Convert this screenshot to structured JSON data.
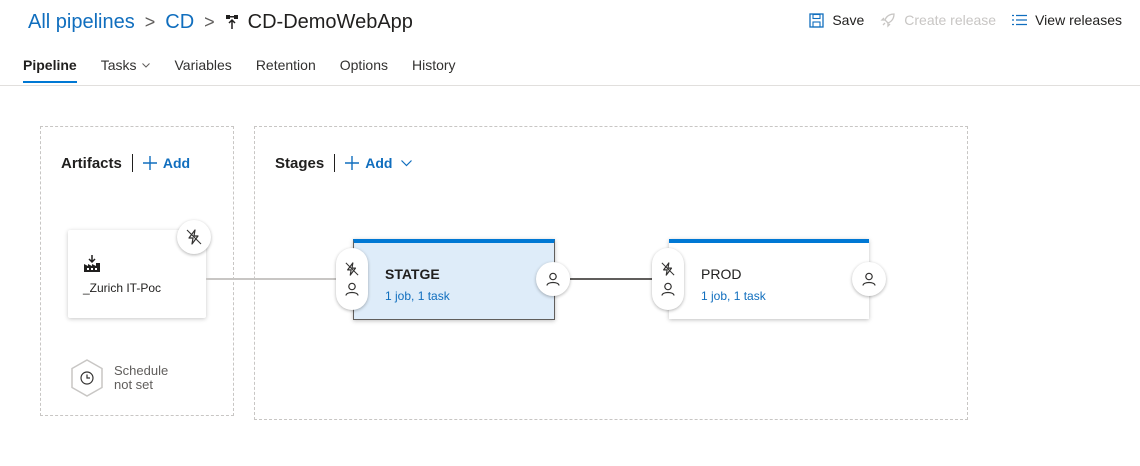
{
  "breadcrumb": {
    "root": "All pipelines",
    "folder": "CD",
    "current": "CD-DemoWebApp",
    "separator": ">"
  },
  "toolbar": {
    "save_label": "Save",
    "create_release_label": "Create release",
    "view_releases_label": "View releases"
  },
  "tabs": [
    {
      "label": "Pipeline",
      "active": true
    },
    {
      "label": "Tasks",
      "active": false
    },
    {
      "label": "Variables",
      "active": false
    },
    {
      "label": "Retention",
      "active": false
    },
    {
      "label": "Options",
      "active": false
    },
    {
      "label": "History",
      "active": false
    }
  ],
  "artifacts": {
    "title": "Artifacts",
    "add_label": "Add",
    "items": [
      {
        "name": "_Zurich IT-Poc",
        "icon": "build-icon"
      }
    ],
    "schedule": {
      "line1": "Schedule",
      "line2": "not set"
    }
  },
  "stages": {
    "title": "Stages",
    "add_label": "Add",
    "items": [
      {
        "name": "STATGE",
        "summary": "1 job, 1 task",
        "selected": true
      },
      {
        "name": "PROD",
        "summary": "1 job, 1 task",
        "selected": false
      }
    ]
  },
  "colors": {
    "accent": "#0078d4",
    "link": "#106ebe",
    "selected_bg": "#deecf9"
  }
}
